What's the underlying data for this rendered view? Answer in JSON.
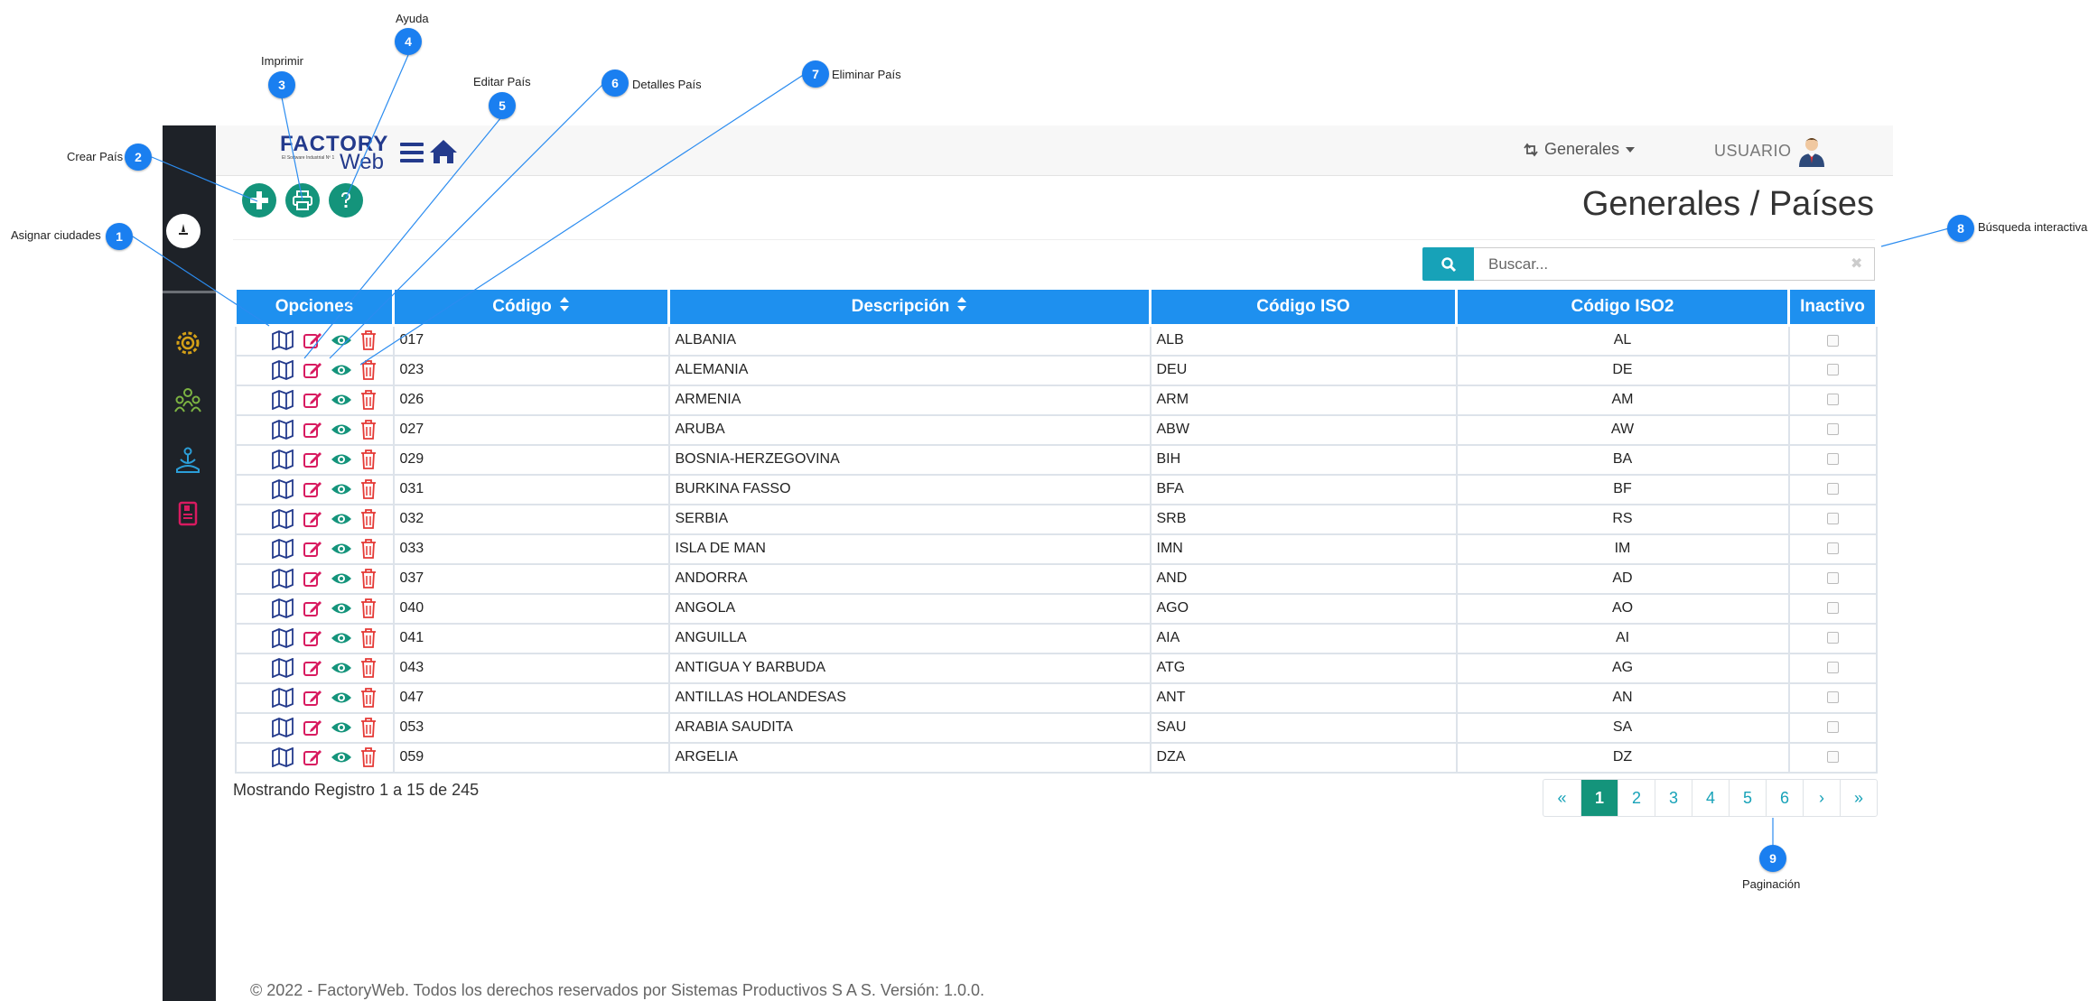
{
  "annotations": [
    {
      "number": "1",
      "label": "Asignar ciudades"
    },
    {
      "number": "2",
      "label": "Crear País"
    },
    {
      "number": "3",
      "label": "Imprimir"
    },
    {
      "number": "4",
      "label": "Ayuda"
    },
    {
      "number": "5",
      "label": "Editar País"
    },
    {
      "number": "6",
      "label": "Detalles País"
    },
    {
      "number": "7",
      "label": "Eliminar País"
    },
    {
      "number": "8",
      "label": "Búsqueda interactiva"
    },
    {
      "number": "9",
      "label": "Paginación"
    }
  ],
  "header": {
    "menu_label": "Generales",
    "user_label": "USUARIO"
  },
  "page": {
    "title": "Generales / Países"
  },
  "search": {
    "placeholder": "Buscar...",
    "clear_glyph": "✖"
  },
  "table": {
    "columns": [
      "Opciones",
      "Código",
      "Descripción",
      "Código ISO",
      "Código ISO2",
      "Inactivo"
    ],
    "rows": [
      {
        "codigo": "017",
        "descripcion": "ALBANIA",
        "iso": "ALB",
        "iso2": "AL"
      },
      {
        "codigo": "023",
        "descripcion": "ALEMANIA",
        "iso": "DEU",
        "iso2": "DE"
      },
      {
        "codigo": "026",
        "descripcion": "ARMENIA",
        "iso": "ARM",
        "iso2": "AM"
      },
      {
        "codigo": "027",
        "descripcion": "ARUBA",
        "iso": "ABW",
        "iso2": "AW"
      },
      {
        "codigo": "029",
        "descripcion": "BOSNIA-HERZEGOVINA",
        "iso": "BIH",
        "iso2": "BA"
      },
      {
        "codigo": "031",
        "descripcion": "BURKINA FASSO",
        "iso": "BFA",
        "iso2": "BF"
      },
      {
        "codigo": "032",
        "descripcion": "SERBIA",
        "iso": "SRB",
        "iso2": "RS"
      },
      {
        "codigo": "033",
        "descripcion": "ISLA DE MAN",
        "iso": "IMN",
        "iso2": "IM"
      },
      {
        "codigo": "037",
        "descripcion": "ANDORRA",
        "iso": "AND",
        "iso2": "AD"
      },
      {
        "codigo": "040",
        "descripcion": "ANGOLA",
        "iso": "AGO",
        "iso2": "AO"
      },
      {
        "codigo": "041",
        "descripcion": "ANGUILLA",
        "iso": "AIA",
        "iso2": "AI"
      },
      {
        "codigo": "043",
        "descripcion": "ANTIGUA Y BARBUDA",
        "iso": "ATG",
        "iso2": "AG"
      },
      {
        "codigo": "047",
        "descripcion": "ANTILLAS HOLANDESAS",
        "iso": "ANT",
        "iso2": "AN"
      },
      {
        "codigo": "053",
        "descripcion": "ARABIA SAUDITA",
        "iso": "SAU",
        "iso2": "SA"
      },
      {
        "codigo": "059",
        "descripcion": "ARGELIA",
        "iso": "DZA",
        "iso2": "DZ"
      }
    ]
  },
  "pagination": {
    "summary": "Mostrando Registro 1 a 15 de 245",
    "items": [
      "«",
      "1",
      "2",
      "3",
      "4",
      "5",
      "6",
      "›",
      "»"
    ],
    "active": "1"
  },
  "footer": {
    "text": "© 2022 - FactoryWeb. Todos los derechos reservados por Sistemas Productivos S A S. Versión: 1.0.0."
  },
  "colors": {
    "header_blue": "#1e90ef",
    "action_green": "#14947b",
    "search_teal": "#17a2b8",
    "callout_blue": "#1a7ff0",
    "sidebar": "#1e2228"
  },
  "icons": {
    "options_row": [
      "map-icon",
      "edit-icon",
      "eye-icon",
      "trash-icon"
    ],
    "sidebar": [
      "gear-icon",
      "people-icon",
      "meditation-icon",
      "book-icon"
    ],
    "toolbar": [
      "plus-icon",
      "print-icon",
      "help-icon"
    ]
  }
}
